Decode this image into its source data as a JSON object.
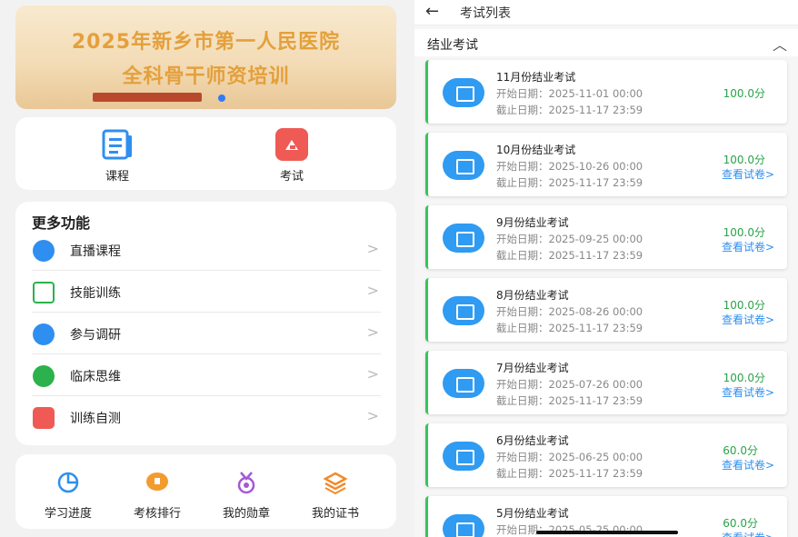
{
  "banner": {
    "line1": "2025年新乡市第一人民医院",
    "line2": "全科骨干师资培训"
  },
  "main": {
    "course": "课程",
    "exam": "考试"
  },
  "more": {
    "title": "更多功能",
    "items": [
      {
        "label": "直播课程",
        "icon": "live-course-icon",
        "color": "#2f8ff0"
      },
      {
        "label": "技能训练",
        "icon": "skill-calendar-icon",
        "color": "#2bb24c"
      },
      {
        "label": "参与调研",
        "icon": "survey-icon",
        "color": "#2f8ff0"
      },
      {
        "label": "临床思维",
        "icon": "bulb-icon",
        "color": "#2bb24c"
      },
      {
        "label": "训练自测",
        "icon": "self-test-icon",
        "color": "#ef5a55"
      }
    ],
    "chevron": ">"
  },
  "bottom": {
    "items": [
      {
        "label": "学习进度",
        "icon": "progress-pie-icon"
      },
      {
        "label": "考核排行",
        "icon": "trophy-icon"
      },
      {
        "label": "我的勋章",
        "icon": "medal-icon"
      },
      {
        "label": "我的证书",
        "icon": "certificate-layers-icon"
      }
    ]
  },
  "right": {
    "back": "←",
    "title": "考试列表",
    "section": "结业考试",
    "collapse": "︿",
    "view_label": "查看试卷>",
    "exams": [
      {
        "title": "11月份结业考试",
        "start": "开始日期：2025-11-01 00:00",
        "end": "截止日期：2025-11-17 23:59",
        "score": "100.0分",
        "view": false
      },
      {
        "title": "10月份结业考试",
        "start": "开始日期：2025-10-26 00:00",
        "end": "截止日期：2025-11-17 23:59",
        "score": "100.0分",
        "view": true
      },
      {
        "title": "9月份结业考试",
        "start": "开始日期：2025-09-25 00:00",
        "end": "截止日期：2025-11-17 23:59",
        "score": "100.0分",
        "view": true
      },
      {
        "title": "8月份结业考试",
        "start": "开始日期：2025-08-26 00:00",
        "end": "截止日期：2025-11-17 23:59",
        "score": "100.0分",
        "view": true
      },
      {
        "title": "7月份结业考试",
        "start": "开始日期：2025-07-26 00:00",
        "end": "截止日期：2025-11-17 23:59",
        "score": "100.0分",
        "view": true
      },
      {
        "title": "6月份结业考试",
        "start": "开始日期：2025-06-25 00:00",
        "end": "截止日期：2025-11-17 23:59",
        "score": "60.0分",
        "view": true
      },
      {
        "title": "5月份结业考试",
        "start": "开始日期：2025-05-25 00:00",
        "end": "",
        "score": "60.0分",
        "view": true
      }
    ]
  },
  "colors": {
    "accent_blue": "#2f8ff0",
    "score_green": "#2aa34a",
    "card_border_green": "#34c759",
    "banner_text": "#e4a03c"
  }
}
